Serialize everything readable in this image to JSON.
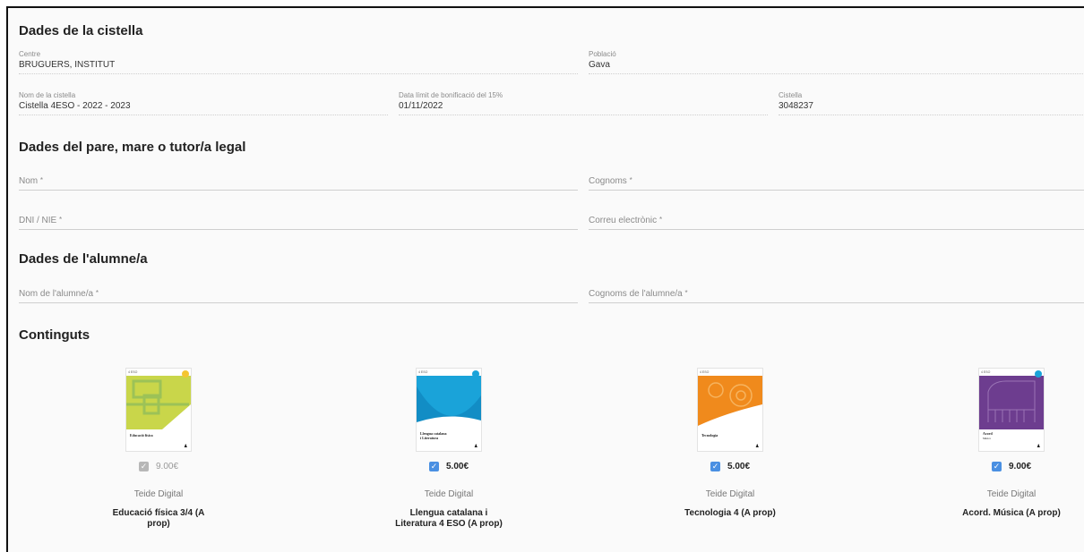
{
  "basket": {
    "title": "Dades de la cistella",
    "centre_label": "Centre",
    "centre_value": "BRUGUERS, INSTITUT",
    "city_label": "Població",
    "city_value": "Gava",
    "name_label": "Nom de la cistella",
    "name_value": "Cistella 4ESO - 2022 - 2023",
    "deadline_label": "Data límit de bonificació del 15%",
    "deadline_value": "01/11/2022",
    "id_label": "Cistella",
    "id_value": "3048237"
  },
  "parent": {
    "title": "Dades del pare, mare o tutor/a legal",
    "first_name_placeholder": "Nom",
    "last_name_placeholder": "Cognoms",
    "dni_placeholder": "DNI / NIE",
    "email_placeholder": "Correu electrònic",
    "required_mark": "*"
  },
  "student": {
    "title": "Dades de l'alumne/a",
    "first_name_placeholder": "Nom de l'alumne/a",
    "last_name_placeholder": "Cognoms de l'alumne/a"
  },
  "contents": {
    "title": "Continguts",
    "products": [
      {
        "price": "9.00€",
        "publisher": "Teide Digital",
        "name": "Educació física 3/4 (A prop)",
        "cover_title": "Educació física",
        "checked": true,
        "disabled": true,
        "cover_color": "#c9d64a"
      },
      {
        "price": "5.00€",
        "publisher": "Teide Digital",
        "name": "Llengua catalana i Literatura 4 ESO (A prop)",
        "cover_title": "Llengua catalana i Literatura",
        "checked": true,
        "disabled": false,
        "cover_color": "#1aa3d9"
      },
      {
        "price": "5.00€",
        "publisher": "Teide Digital",
        "name": "Tecnologia 4 (A prop)",
        "cover_title": "Tecnologia",
        "checked": true,
        "disabled": false,
        "cover_color": "#f08a1c"
      },
      {
        "price": "9.00€",
        "publisher": "Teide Digital",
        "name": "Acord. Música (A prop)",
        "cover_title": "Acord Música",
        "checked": true,
        "disabled": false,
        "cover_color": "#6d3d8f"
      }
    ]
  },
  "colors": {
    "accent": "#4a90e2",
    "frame": "#111111"
  }
}
